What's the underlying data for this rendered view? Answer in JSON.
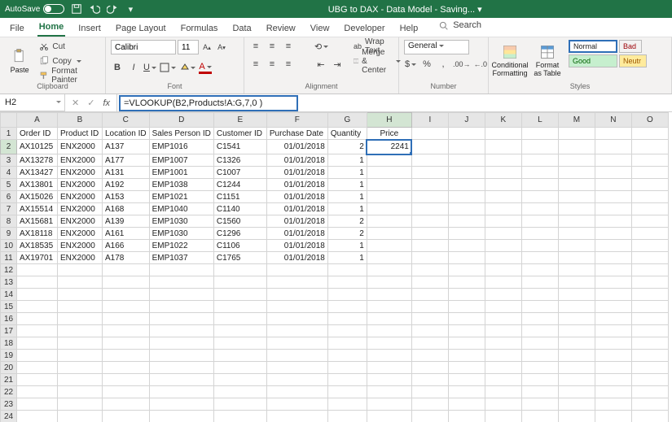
{
  "titlebar": {
    "autosave_label": "AutoSave",
    "autosave_state": "On",
    "doc_title": "UBG to DAX - Data Model - Saving... ▾"
  },
  "menutabs": {
    "items": [
      "File",
      "Home",
      "Insert",
      "Page Layout",
      "Formulas",
      "Data",
      "Review",
      "View",
      "Developer",
      "Help"
    ],
    "active": 1,
    "search_placeholder": "Search"
  },
  "ribbon": {
    "clipboard": {
      "paste": "Paste",
      "cut": "Cut",
      "copy": "Copy",
      "fmtpaint": "Format Painter",
      "label": "Clipboard"
    },
    "font": {
      "name": "Calibri",
      "size": "11",
      "label": "Font"
    },
    "alignment": {
      "wrap": "Wrap Text",
      "merge": "Merge & Center",
      "label": "Alignment"
    },
    "number": {
      "format": "General",
      "label": "Number"
    },
    "styles": {
      "cond": "Conditional Formatting",
      "fat": "Format as Table",
      "normal": "Normal",
      "bad": "Bad",
      "good": "Good",
      "neut": "Neutr",
      "label": "Styles"
    }
  },
  "namebox": "H2",
  "formula": "=VLOOKUP(B2,Products!A:G,7,0 )",
  "columns": [
    "A",
    "B",
    "C",
    "D",
    "E",
    "F",
    "G",
    "H",
    "I",
    "J",
    "K",
    "L",
    "M",
    "N",
    "O"
  ],
  "headers": {
    "A": "Order ID",
    "B": "Product ID",
    "C": "Location ID",
    "D": "Sales Person ID",
    "E": "Customer ID",
    "F": "Purchase Date",
    "G": "Quantity",
    "H": "Price"
  },
  "rows": [
    {
      "A": "AX10125",
      "B": "ENX2000",
      "C": "A137",
      "D": "EMP1016",
      "E": "C1541",
      "F": "01/01/2018",
      "G": "2",
      "H": "2241"
    },
    {
      "A": "AX13278",
      "B": "ENX2000",
      "C": "A177",
      "D": "EMP1007",
      "E": "C1326",
      "F": "01/01/2018",
      "G": "1",
      "H": ""
    },
    {
      "A": "AX13427",
      "B": "ENX2000",
      "C": "A131",
      "D": "EMP1001",
      "E": "C1007",
      "F": "01/01/2018",
      "G": "1",
      "H": ""
    },
    {
      "A": "AX13801",
      "B": "ENX2000",
      "C": "A192",
      "D": "EMP1038",
      "E": "C1244",
      "F": "01/01/2018",
      "G": "1",
      "H": ""
    },
    {
      "A": "AX15026",
      "B": "ENX2000",
      "C": "A153",
      "D": "EMP1021",
      "E": "C1151",
      "F": "01/01/2018",
      "G": "1",
      "H": ""
    },
    {
      "A": "AX15514",
      "B": "ENX2000",
      "C": "A168",
      "D": "EMP1040",
      "E": "C1140",
      "F": "01/01/2018",
      "G": "1",
      "H": ""
    },
    {
      "A": "AX15681",
      "B": "ENX2000",
      "C": "A139",
      "D": "EMP1030",
      "E": "C1560",
      "F": "01/01/2018",
      "G": "2",
      "H": ""
    },
    {
      "A": "AX18118",
      "B": "ENX2000",
      "C": "A161",
      "D": "EMP1030",
      "E": "C1296",
      "F": "01/01/2018",
      "G": "2",
      "H": ""
    },
    {
      "A": "AX18535",
      "B": "ENX2000",
      "C": "A166",
      "D": "EMP1022",
      "E": "C1106",
      "F": "01/01/2018",
      "G": "1",
      "H": ""
    },
    {
      "A": "AX19701",
      "B": "ENX2000",
      "C": "A178",
      "D": "EMP1037",
      "E": "C1765",
      "F": "01/01/2018",
      "G": "1",
      "H": ""
    }
  ],
  "active_cell": "H2",
  "total_rows": 24
}
